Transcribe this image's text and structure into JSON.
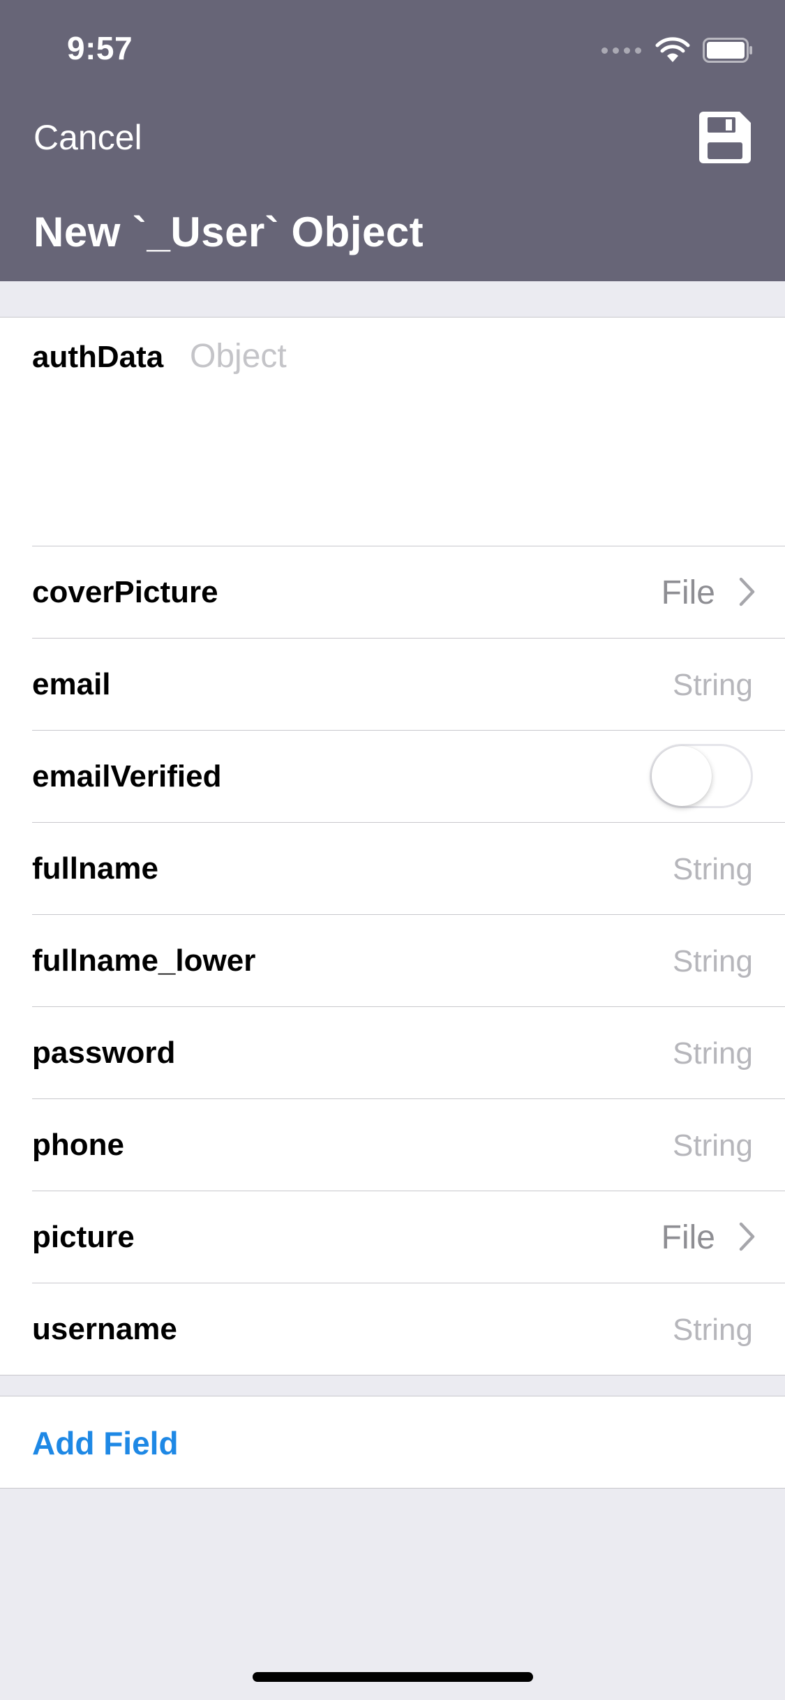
{
  "status_bar": {
    "time": "9:57"
  },
  "nav": {
    "cancel_label": "Cancel",
    "title": "New `_User` Object",
    "save_icon": "save-icon"
  },
  "form": {
    "object_field": {
      "label": "authData",
      "placeholder": "Object"
    },
    "fields": [
      {
        "label": "coverPicture",
        "type": "File",
        "kind": "file"
      },
      {
        "label": "email",
        "type": "String",
        "kind": "string"
      },
      {
        "label": "emailVerified",
        "kind": "toggle",
        "value": false
      },
      {
        "label": "fullname",
        "type": "String",
        "kind": "string"
      },
      {
        "label": "fullname_lower",
        "type": "String",
        "kind": "string"
      },
      {
        "label": "password",
        "type": "String",
        "kind": "string"
      },
      {
        "label": "phone",
        "type": "String",
        "kind": "string"
      },
      {
        "label": "picture",
        "type": "File",
        "kind": "file"
      },
      {
        "label": "username",
        "type": "String",
        "kind": "string"
      }
    ]
  },
  "actions": {
    "add_field_label": "Add Field"
  },
  "colors": {
    "header": "#676577",
    "accent": "#1e88e5",
    "background": "#ebebf1"
  }
}
